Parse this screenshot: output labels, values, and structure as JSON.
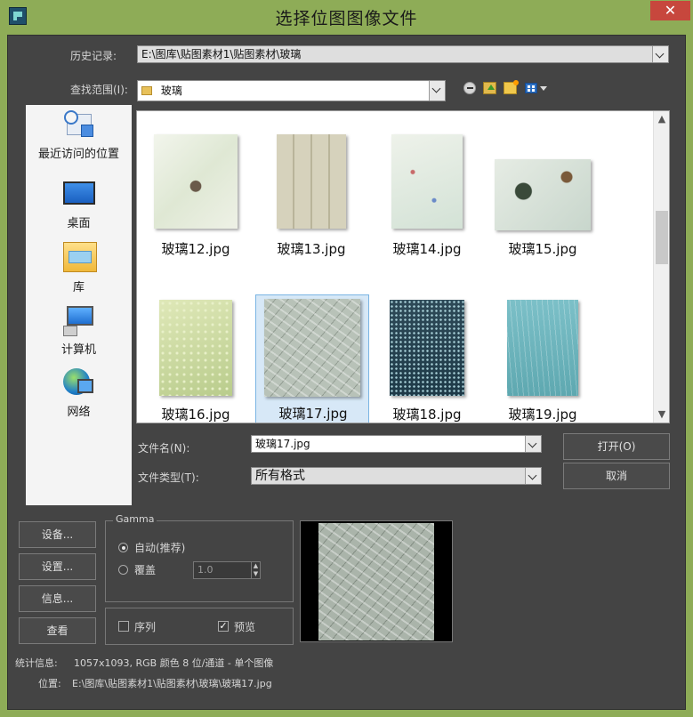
{
  "window": {
    "title": "选择位图图像文件",
    "close_glyph": "✕"
  },
  "history": {
    "label": "历史记录:",
    "value": "E:\\图库\\贴图素材1\\贴图素材\\玻璃"
  },
  "lookin": {
    "label": "查找范围(I):",
    "value": "玻璃",
    "toolbar_icons": [
      "back-icon",
      "up-folder-icon",
      "new-folder-icon",
      "view-menu-icon"
    ]
  },
  "places": [
    {
      "label": "最近访问的位置",
      "icon": "recent-places-icon"
    },
    {
      "label": "桌面",
      "icon": "desktop-icon"
    },
    {
      "label": "库",
      "icon": "library-icon"
    },
    {
      "label": "计算机",
      "icon": "computer-icon"
    },
    {
      "label": "网络",
      "icon": "network-icon"
    }
  ],
  "files": [
    {
      "name": "玻璃12.jpg",
      "selected": false
    },
    {
      "name": "玻璃13.jpg",
      "selected": false
    },
    {
      "name": "玻璃14.jpg",
      "selected": false
    },
    {
      "name": "玻璃15.jpg",
      "selected": false
    },
    {
      "name": "玻璃16.jpg",
      "selected": false
    },
    {
      "name": "玻璃17.jpg",
      "selected": true
    },
    {
      "name": "玻璃18.jpg",
      "selected": false
    },
    {
      "name": "玻璃19.jpg",
      "selected": false
    }
  ],
  "filename": {
    "label": "文件名(N):",
    "value": "玻璃17.jpg"
  },
  "filetype": {
    "label": "文件类型(T):",
    "value": "所有格式"
  },
  "buttons": {
    "open": "打开(O)",
    "cancel": "取消"
  },
  "side_buttons": {
    "setup": "设备...",
    "settings": "设置...",
    "info": "信息...",
    "view": "查看"
  },
  "gamma": {
    "title": "Gamma",
    "auto_label": "自动(推荐)",
    "override_label": "覆盖",
    "override_value": "1.0",
    "selected": "auto"
  },
  "options": {
    "sequence_label": "序列",
    "sequence_checked": false,
    "preview_label": "预览",
    "preview_checked": true
  },
  "stats": {
    "label": "统计信息:",
    "value": "1057x1093, RGB 颜色 8 位/通道 - 单个图像"
  },
  "location": {
    "label": "位置:",
    "value": "E:\\图库\\贴图素材1\\贴图素材\\玻璃\\玻璃17.jpg"
  },
  "colors": {
    "frame": "#8eac57",
    "client": "#444444",
    "close": "#c7473d",
    "selection": "#d7e8f7"
  }
}
